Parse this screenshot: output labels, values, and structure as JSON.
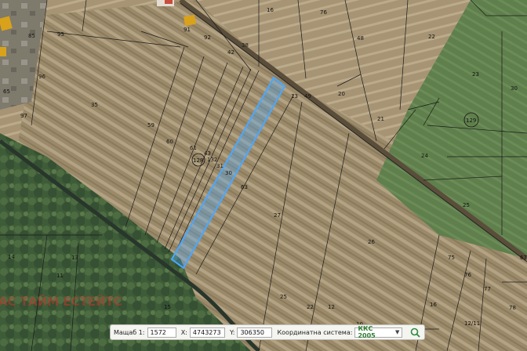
{
  "map": {
    "parcels": [
      {
        "id": "p16a",
        "label": "16"
      },
      {
        "id": "p76",
        "label": "76"
      },
      {
        "id": "p48",
        "label": "48"
      },
      {
        "id": "p22a",
        "label": "22"
      },
      {
        "id": "p38",
        "label": "38"
      },
      {
        "id": "p42",
        "label": "42"
      },
      {
        "id": "p92",
        "label": "92"
      },
      {
        "id": "p91",
        "label": "91"
      },
      {
        "id": "p95",
        "label": "95"
      },
      {
        "id": "p85",
        "label": "85"
      },
      {
        "id": "p96",
        "label": "96"
      },
      {
        "id": "p65",
        "label": "65"
      },
      {
        "id": "p97",
        "label": "97"
      },
      {
        "id": "p35",
        "label": "35"
      },
      {
        "id": "p59",
        "label": "59"
      },
      {
        "id": "p60",
        "label": "60"
      },
      {
        "id": "p61",
        "label": "61"
      },
      {
        "id": "p43",
        "label": "43"
      },
      {
        "id": "p132",
        "label": "132"
      },
      {
        "id": "p31",
        "label": "31"
      },
      {
        "id": "p30",
        "label": "30"
      },
      {
        "id": "p63",
        "label": "63"
      },
      {
        "id": "p13",
        "label": "13"
      },
      {
        "id": "p49",
        "label": "49"
      },
      {
        "id": "p20",
        "label": "20"
      },
      {
        "id": "p21",
        "label": "21"
      },
      {
        "id": "p23",
        "label": "23"
      },
      {
        "id": "p30b",
        "label": "30"
      },
      {
        "id": "p24",
        "label": "24"
      },
      {
        "id": "p25",
        "label": "25"
      },
      {
        "id": "p27",
        "label": "27"
      },
      {
        "id": "p26",
        "label": "26"
      },
      {
        "id": "p75",
        "label": "75"
      },
      {
        "id": "p76b",
        "label": "76"
      },
      {
        "id": "p77",
        "label": "77"
      },
      {
        "id": "p78",
        "label": "78"
      },
      {
        "id": "p67",
        "label": "67"
      },
      {
        "id": "p16b",
        "label": "16"
      },
      {
        "id": "p25b",
        "label": "25"
      },
      {
        "id": "p22b",
        "label": "22"
      },
      {
        "id": "p12",
        "label": "12"
      },
      {
        "id": "p13b",
        "label": "13"
      },
      {
        "id": "p11",
        "label": "11"
      },
      {
        "id": "p14",
        "label": "14"
      },
      {
        "id": "p1211",
        "label": "12/11"
      },
      {
        "id": "p10",
        "label": "10"
      },
      {
        "id": "p15",
        "label": "15"
      }
    ],
    "circled_labels": [
      {
        "id": "c128",
        "label": "128"
      },
      {
        "id": "c129",
        "label": "129"
      }
    ],
    "watermark": "АС ТАЙМ ЕСТЕЙТС",
    "highlight_color": "#4aa8ff"
  },
  "statusbar": {
    "scale_label": "Мащаб 1:",
    "scale_value": "1572",
    "x_label": "X:",
    "x_value": "4743273",
    "y_label": "Y:",
    "y_value": "306350",
    "crs_label": "Координатна система:",
    "crs_value": "ККС 2005",
    "crs_icon": "chevron-down-icon",
    "search_icon": "search-icon"
  }
}
